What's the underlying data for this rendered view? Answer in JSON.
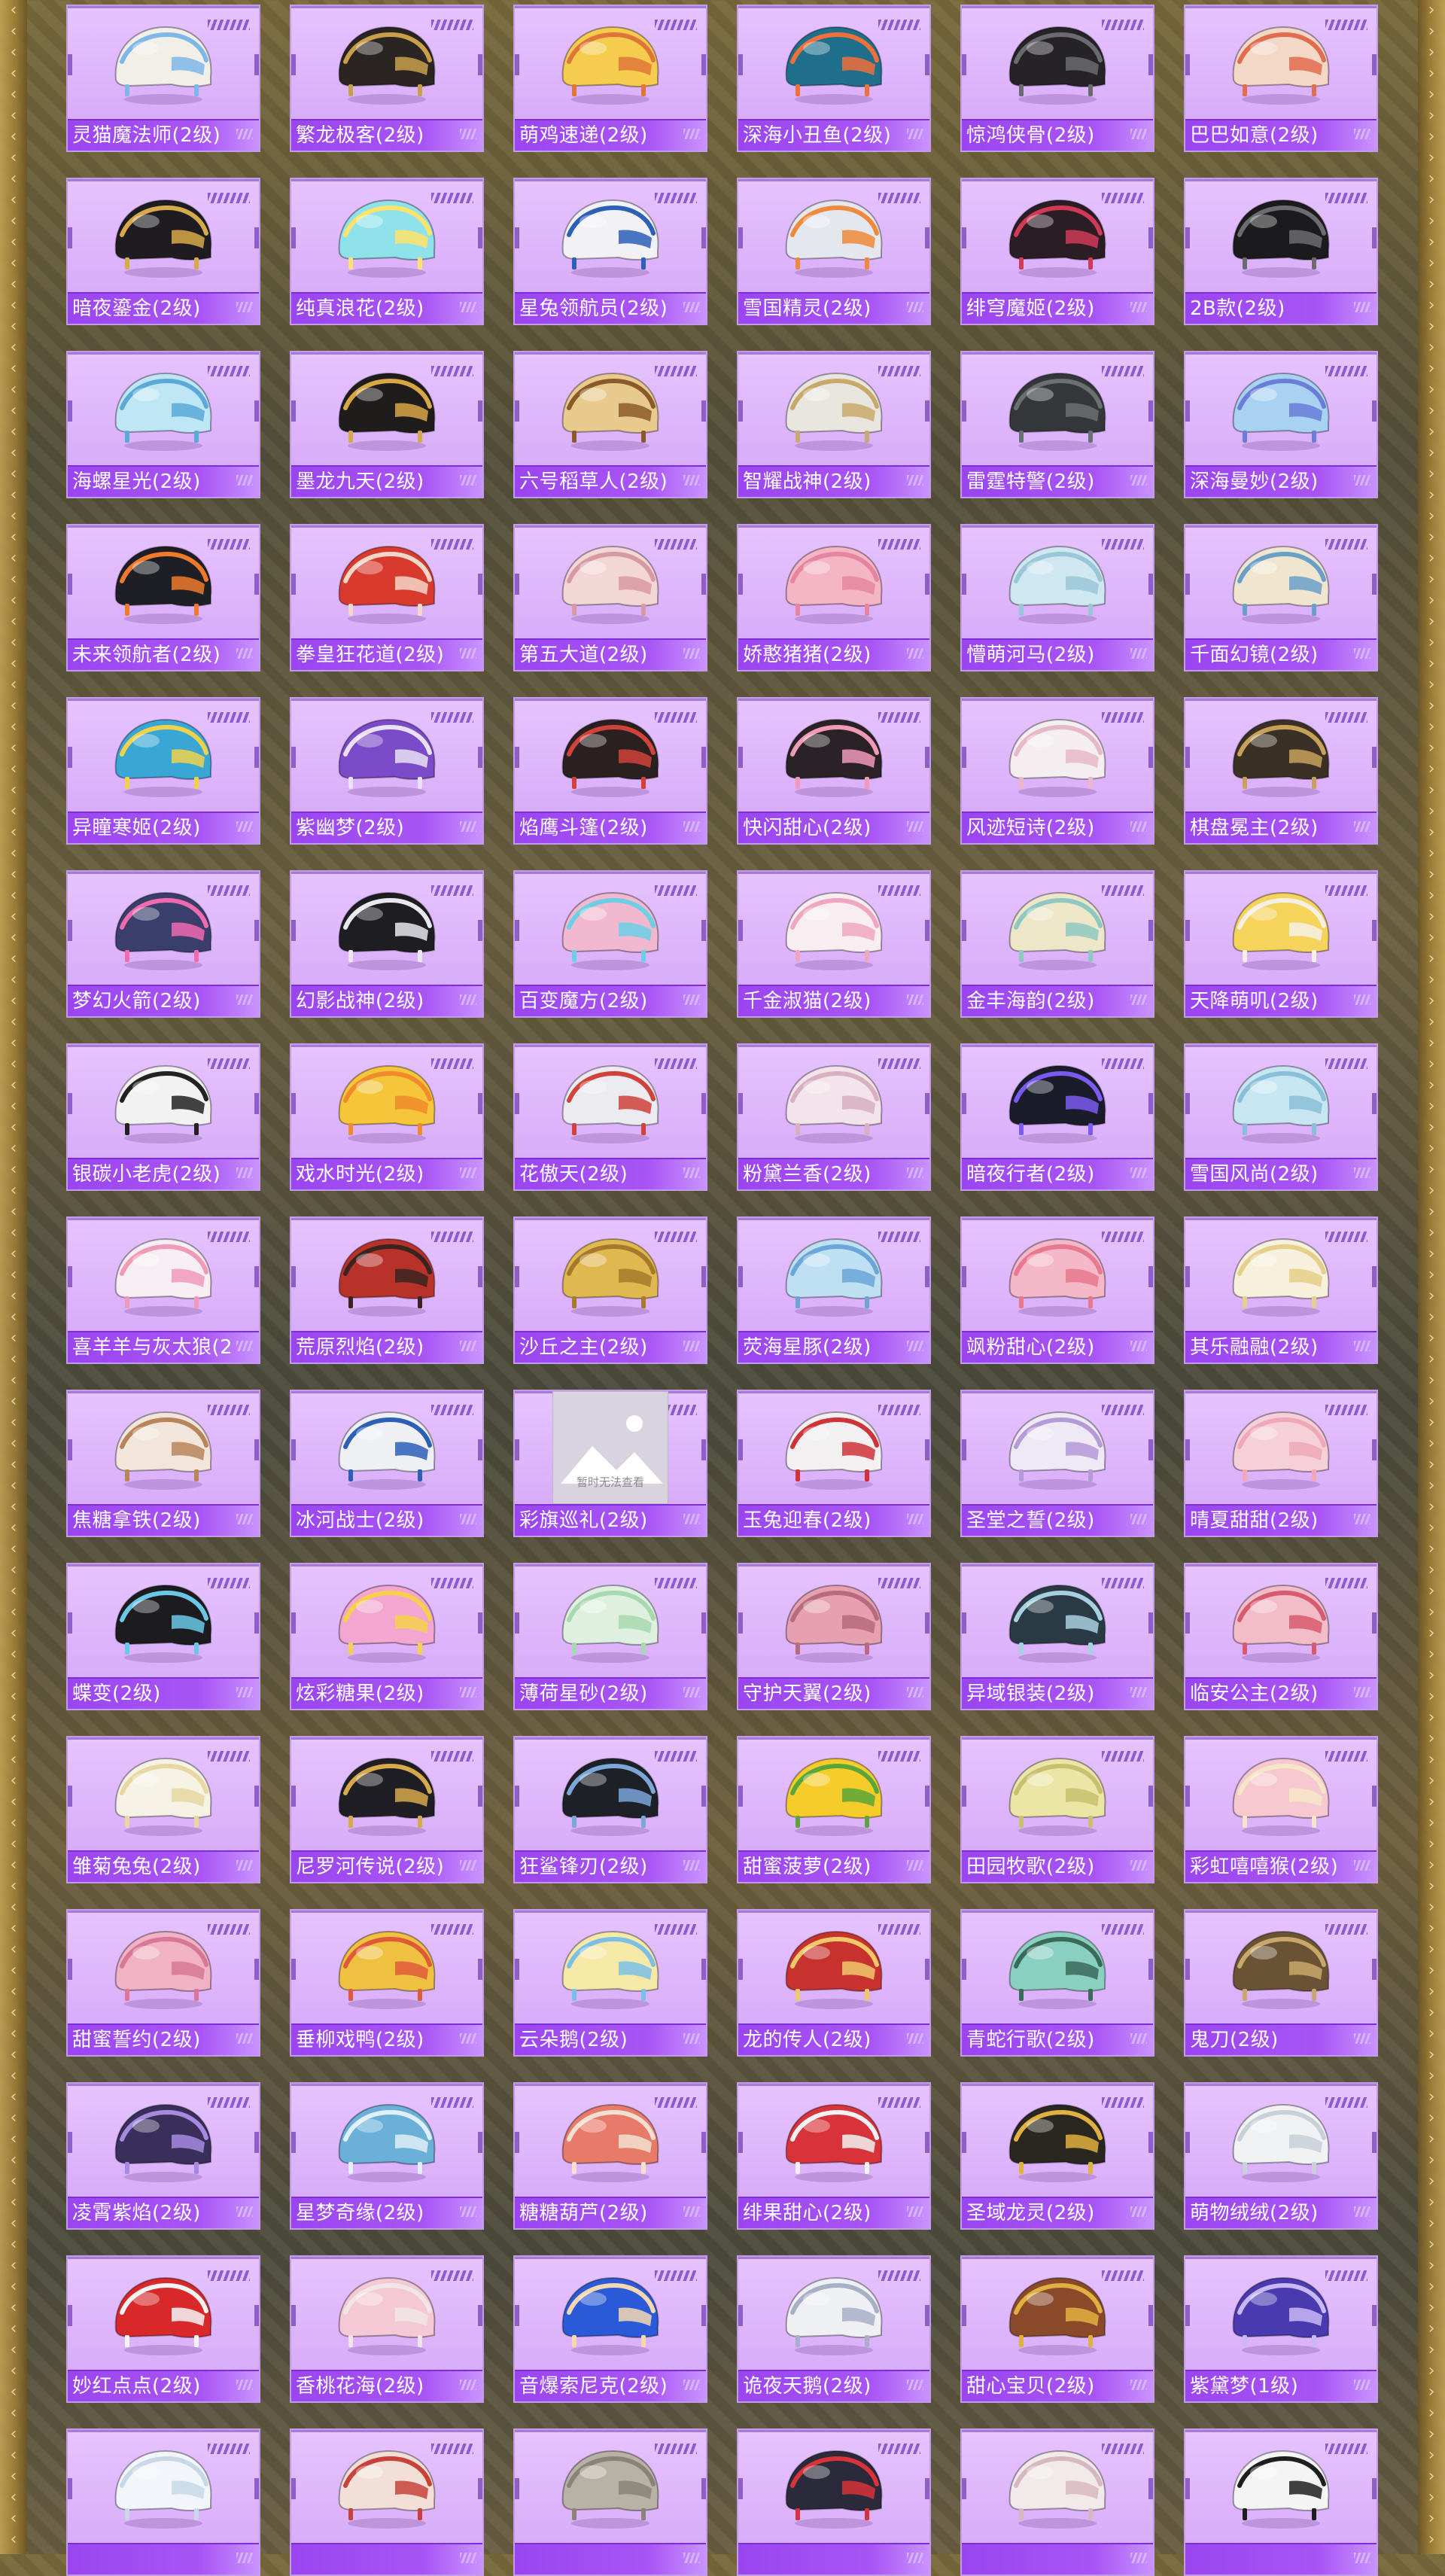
{
  "placeholder_text": "暂时无法查看",
  "colors": {
    "card_bg": "#e6c4ff",
    "label_bar": "#9a45f0",
    "label_text": "#ffffff"
  },
  "items": [
    {
      "label": "灵猫魔法师(2级)",
      "color": "#f1efe8",
      "accent": "#7fb7e8",
      "icon": "helmet-icon"
    },
    {
      "label": "繁龙极客(2级)",
      "color": "#2a2422",
      "accent": "#c8a04a",
      "icon": "helmet-icon"
    },
    {
      "label": "萌鸡速递(2级)",
      "color": "#f5cc4e",
      "accent": "#e0753a",
      "icon": "helmet-icon"
    },
    {
      "label": "深海小丑鱼(2级)",
      "color": "#1f6f8c",
      "accent": "#f0703a",
      "icon": "helmet-icon"
    },
    {
      "label": "惊鸿侠骨(2级)",
      "color": "#252326",
      "accent": "#6a6a70",
      "icon": "helmet-icon"
    },
    {
      "label": "巴巴如意(2级)",
      "color": "#f3d8c8",
      "accent": "#e26c4e",
      "icon": "helmet-icon"
    },
    {
      "label": "暗夜鎏金(2级)",
      "color": "#1e1c20",
      "accent": "#d6a94a",
      "icon": "helmet-icon"
    },
    {
      "label": "纯真浪花(2级)",
      "color": "#8fe1ea",
      "accent": "#ffe36a",
      "icon": "helmet-icon"
    },
    {
      "label": "星兔领航员(2级)",
      "color": "#f2f2f6",
      "accent": "#2c5fb8",
      "icon": "helmet-icon"
    },
    {
      "label": "雪国精灵(2级)",
      "color": "#e4e8ee",
      "accent": "#f08a3a",
      "icon": "helmet-icon"
    },
    {
      "label": "绯穹魔姬(2级)",
      "color": "#2b1d24",
      "accent": "#d03a58",
      "icon": "helmet-icon"
    },
    {
      "label": "2B款(2级)",
      "color": "#1b1b1d",
      "accent": "#6b6b70",
      "icon": "helmet-icon"
    },
    {
      "label": "海螺星光(2级)",
      "color": "#bfe6f5",
      "accent": "#5aa9d8",
      "icon": "helmet-icon"
    },
    {
      "label": "墨龙九天(2级)",
      "color": "#1f1d1c",
      "accent": "#d9a646",
      "icon": "helmet-icon"
    },
    {
      "label": "六号稻草人(2级)",
      "color": "#e8c98e",
      "accent": "#8a5a2a",
      "icon": "helmet-icon"
    },
    {
      "label": "智耀战神(2级)",
      "color": "#e9e6df",
      "accent": "#c9a96b",
      "icon": "helmet-icon"
    },
    {
      "label": "雷霆特警(2级)",
      "color": "#34373a",
      "accent": "#6a7072",
      "icon": "helmet-icon"
    },
    {
      "label": "深海曼妙(2级)",
      "color": "#a9d2f2",
      "accent": "#6a7ed8",
      "icon": "helmet-icon"
    },
    {
      "label": "未来领航者(2级)",
      "color": "#1e1f24",
      "accent": "#f07a2a",
      "icon": "helmet-icon"
    },
    {
      "label": "拳皇狂花道(2级)",
      "color": "#d93a2e",
      "accent": "#f4d7c8",
      "icon": "helmet-icon"
    },
    {
      "label": "第五大道(2级)",
      "color": "#f3d6d6",
      "accent": "#d89aa2",
      "icon": "helmet-icon"
    },
    {
      "label": "娇憨猪猪(2级)",
      "color": "#f4b6c4",
      "accent": "#e685a0",
      "icon": "helmet-icon"
    },
    {
      "label": "懵萌河马(2级)",
      "color": "#cfe7f0",
      "accent": "#9ac6d8",
      "icon": "helmet-icon"
    },
    {
      "label": "千面幻镜(2级)",
      "color": "#f0e6d0",
      "accent": "#6aa0c8",
      "icon": "helmet-icon"
    },
    {
      "label": "异瞳寒姬(2级)",
      "color": "#3aa6d6",
      "accent": "#f0d24a",
      "icon": "helmet-icon"
    },
    {
      "label": "紫幽梦(2级)",
      "color": "#7a4ac8",
      "accent": "#e9e2f6",
      "icon": "helmet-icon"
    },
    {
      "label": "焰鹰斗篷(2级)",
      "color": "#2a2020",
      "accent": "#d0423a",
      "icon": "helmet-icon"
    },
    {
      "label": "快闪甜心(2级)",
      "color": "#2a2226",
      "accent": "#f09ab8",
      "icon": "helmet-icon"
    },
    {
      "label": "风迹短诗(2级)",
      "color": "#f4eef0",
      "accent": "#e6b8c8",
      "icon": "helmet-icon"
    },
    {
      "label": "棋盘冕主(2级)",
      "color": "#3a3026",
      "accent": "#c8a05a",
      "icon": "helmet-icon"
    },
    {
      "label": "梦幻火箭(2级)",
      "color": "#3a3e6a",
      "accent": "#f06ab0",
      "icon": "helmet-icon"
    },
    {
      "label": "幻影战神(2级)",
      "color": "#1d1d22",
      "accent": "#e8e8ee",
      "icon": "helmet-icon"
    },
    {
      "label": "百变魔方(2级)",
      "color": "#f2b8d0",
      "accent": "#6ad0e6",
      "icon": "helmet-icon"
    },
    {
      "label": "千金淑猫(2级)",
      "color": "#f8eef2",
      "accent": "#f0a6c0",
      "icon": "helmet-icon"
    },
    {
      "label": "金丰海韵(2级)",
      "color": "#ede6c8",
      "accent": "#8fc8c0",
      "icon": "helmet-icon"
    },
    {
      "label": "天降萌叽(2级)",
      "color": "#f6d35a",
      "accent": "#f4f0e8",
      "icon": "helmet-icon"
    },
    {
      "label": "银碳小老虎(2级)",
      "color": "#f2f2f2",
      "accent": "#222222",
      "icon": "helmet-icon"
    },
    {
      "label": "戏水时光(2级)",
      "color": "#f5c63a",
      "accent": "#f08a2a",
      "icon": "helmet-icon"
    },
    {
      "label": "花傲天(2级)",
      "color": "#ececf0",
      "accent": "#d0423a",
      "icon": "helmet-icon"
    },
    {
      "label": "粉黛兰香(2级)",
      "color": "#f2e4ea",
      "accent": "#d8b0c0",
      "icon": "helmet-icon"
    },
    {
      "label": "暗夜行者(2级)",
      "color": "#1a1c2a",
      "accent": "#7a5af0",
      "icon": "helmet-icon"
    },
    {
      "label": "雪国风尚(2级)",
      "color": "#c8e6f2",
      "accent": "#8abfd8",
      "icon": "helmet-icon"
    },
    {
      "label": "喜羊羊与灰太狼(2",
      "color": "#f6eef2",
      "accent": "#f09ab8",
      "icon": "helmet-icon"
    },
    {
      "label": "荒原烈焰(2级)",
      "color": "#b8322a",
      "accent": "#3a2420",
      "icon": "helmet-icon"
    },
    {
      "label": "沙丘之主(2级)",
      "color": "#e0b850",
      "accent": "#a67a2a",
      "icon": "helmet-icon"
    },
    {
      "label": "荧海星豚(2级)",
      "color": "#bfe0f2",
      "accent": "#6aa6d8",
      "icon": "helmet-icon"
    },
    {
      "label": "飒粉甜心(2级)",
      "color": "#f4b8c8",
      "accent": "#e8788e",
      "icon": "helmet-icon"
    },
    {
      "label": "其乐融融(2级)",
      "color": "#f6f0dc",
      "accent": "#e6cf8a",
      "icon": "helmet-icon"
    },
    {
      "label": "焦糖拿铁(2级)",
      "color": "#f2e6dc",
      "accent": "#b8845a",
      "icon": "helmet-icon"
    },
    {
      "label": "冰河战士(2级)",
      "color": "#eef0f4",
      "accent": "#2c5fb8",
      "icon": "helmet-icon"
    },
    {
      "label": "彩旗巡礼(2级)",
      "placeholder": true,
      "icon": "image-placeholder-icon"
    },
    {
      "label": "玉兔迎春(2级)",
      "color": "#f2f0f0",
      "accent": "#d0323a",
      "icon": "helmet-icon"
    },
    {
      "label": "圣堂之誓(2级)",
      "color": "#efe9f6",
      "accent": "#b59ad8",
      "icon": "helmet-icon"
    },
    {
      "label": "晴夏甜甜(2级)",
      "color": "#f6d0d8",
      "accent": "#f0a8b8",
      "icon": "helmet-icon"
    },
    {
      "label": "蝶变(2级)",
      "color": "#1c1c20",
      "accent": "#6ac8e6",
      "icon": "helmet-icon"
    },
    {
      "label": "炫彩糖果(2级)",
      "color": "#f2a6d0",
      "accent": "#f6d04a",
      "icon": "helmet-icon"
    },
    {
      "label": "薄荷星砂(2级)",
      "color": "#dff0e0",
      "accent": "#a8d8b0",
      "icon": "helmet-icon"
    },
    {
      "label": "守护天翼(2级)",
      "color": "#e6a0b0",
      "accent": "#b86a7e",
      "icon": "helmet-icon"
    },
    {
      "label": "异域银装(2级)",
      "color": "#2a3a44",
      "accent": "#a8d0e0",
      "icon": "helmet-icon"
    },
    {
      "label": "临安公主(2级)",
      "color": "#f2bcc8",
      "accent": "#d85a6e",
      "icon": "helmet-icon"
    },
    {
      "label": "雏菊兔兔(2级)",
      "color": "#f6f2e6",
      "accent": "#e6d8a0",
      "icon": "helmet-icon"
    },
    {
      "label": "尼罗河传说(2级)",
      "color": "#1e1e24",
      "accent": "#d6a94a",
      "icon": "helmet-icon"
    },
    {
      "label": "狂鲨锋刃(2级)",
      "color": "#1e2028",
      "accent": "#7aa6d8",
      "icon": "helmet-icon"
    },
    {
      "label": "甜蜜菠萝(2级)",
      "color": "#f6cc2a",
      "accent": "#5aa63a",
      "icon": "helmet-icon"
    },
    {
      "label": "田园牧歌(2级)",
      "color": "#ece6a6",
      "accent": "#c8c070",
      "icon": "helmet-icon"
    },
    {
      "label": "彩虹嘻嘻猴(2级)",
      "color": "#f6c8d0",
      "accent": "#f6e6c8",
      "icon": "helmet-icon"
    },
    {
      "label": "甜蜜誓约(2级)",
      "color": "#f0b2c4",
      "accent": "#d87896",
      "icon": "helmet-icon"
    },
    {
      "label": "垂柳戏鸭(2级)",
      "color": "#f0c040",
      "accent": "#e05a3a",
      "icon": "helmet-icon"
    },
    {
      "label": "云朵鹅(2级)",
      "color": "#f6e8a6",
      "accent": "#7ac0e6",
      "icon": "helmet-icon"
    },
    {
      "label": "龙的传人(2级)",
      "color": "#c8322e",
      "accent": "#f0c86a",
      "icon": "helmet-icon"
    },
    {
      "label": "青蛇行歌(2级)",
      "color": "#8ad0c0",
      "accent": "#3a6a5a",
      "icon": "helmet-icon"
    },
    {
      "label": "鬼刀(2级)",
      "color": "#6a5234",
      "accent": "#c8a86a",
      "icon": "helmet-icon"
    },
    {
      "label": "凌霄紫焰(2级)",
      "color": "#3a2e5a",
      "accent": "#a68ae0",
      "icon": "helmet-icon"
    },
    {
      "label": "星梦奇缘(2级)",
      "color": "#6ab0d8",
      "accent": "#dff0f8",
      "icon": "helmet-icon"
    },
    {
      "label": "糖糖葫芦(2级)",
      "color": "#e87a6a",
      "accent": "#f4e0d0",
      "icon": "helmet-icon"
    },
    {
      "label": "绯果甜心(2级)",
      "color": "#d8323a",
      "accent": "#f2f2f2",
      "icon": "helmet-icon"
    },
    {
      "label": "圣域龙灵(2级)",
      "color": "#2a2620",
      "accent": "#e0b040",
      "icon": "helmet-icon"
    },
    {
      "label": "萌物绒绒(2级)",
      "color": "#f0f2f4",
      "accent": "#c8d0d8",
      "icon": "helmet-icon"
    },
    {
      "label": "妙红点点(2级)",
      "color": "#d8282a",
      "accent": "#f4f4f4",
      "icon": "helmet-icon"
    },
    {
      "label": "香桃花海(2级)",
      "color": "#f4c8d4",
      "accent": "#f0e6e8",
      "icon": "helmet-icon"
    },
    {
      "label": "音爆索尼克(2级)",
      "color": "#2a5ad8",
      "accent": "#f6d8b0",
      "icon": "helmet-icon"
    },
    {
      "label": "诡夜天鹅(2级)",
      "color": "#eef0f4",
      "accent": "#a8b0c8",
      "icon": "helmet-icon"
    },
    {
      "label": "甜心宝贝(2级)",
      "color": "#8a4a2a",
      "accent": "#e0b040",
      "icon": "helmet-icon"
    },
    {
      "label": "紫黛梦(1级)",
      "color": "#4a3ab0",
      "accent": "#c8b8f6",
      "icon": "helmet-icon"
    },
    {
      "label": "",
      "color": "#f2f6fa",
      "accent": "#c8d8e6",
      "icon": "helmet-icon"
    },
    {
      "label": "",
      "color": "#f2e0d8",
      "accent": "#c8423a",
      "icon": "helmet-icon"
    },
    {
      "label": "",
      "color": "#b8b2a6",
      "accent": "#8a8478",
      "icon": "helmet-icon"
    },
    {
      "label": "",
      "color": "#2a2a3a",
      "accent": "#d8323a",
      "icon": "helmet-icon"
    },
    {
      "label": "",
      "color": "#f2eaea",
      "accent": "#d8b8c0",
      "icon": "helmet-icon"
    },
    {
      "label": "",
      "color": "#f4f4f4",
      "accent": "#1e1e1e",
      "icon": "helmet-icon"
    }
  ]
}
